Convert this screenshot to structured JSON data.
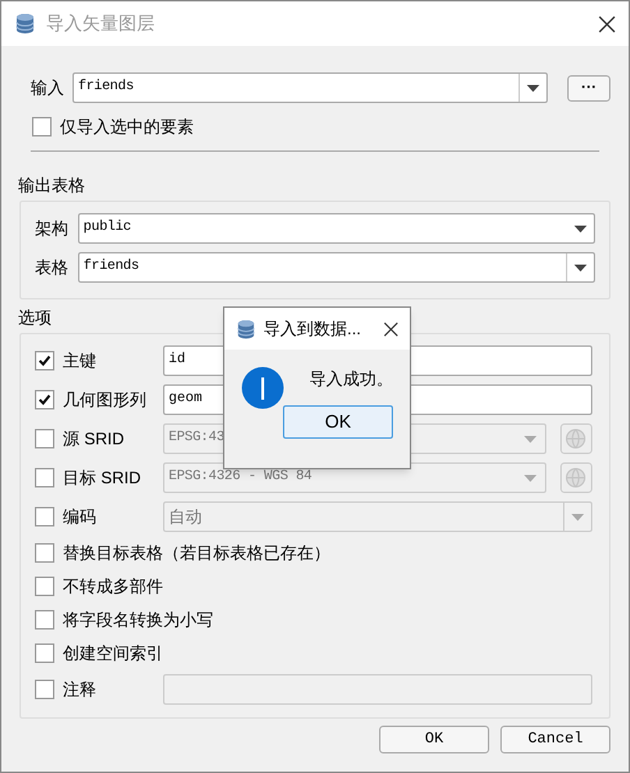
{
  "window": {
    "title": "导入矢量图层"
  },
  "input": {
    "label": "输入",
    "value": "friends",
    "browse": "···"
  },
  "selected_only": {
    "label": "仅导入选中的要素",
    "checked": false
  },
  "output": {
    "title": "输出表格",
    "schema": {
      "label": "架构",
      "value": "public"
    },
    "table": {
      "label": "表格",
      "value": "friends"
    }
  },
  "options": {
    "title": "选项",
    "rows": [
      {
        "kind": "field",
        "label": "主键",
        "checked": true,
        "value": "id"
      },
      {
        "kind": "field",
        "label": "几何图形列",
        "checked": true,
        "value": "geom"
      },
      {
        "kind": "crs",
        "label": "源 SRID",
        "checked": false,
        "value": "EPSG:43"
      },
      {
        "kind": "crs",
        "label": "目标 SRID",
        "checked": false,
        "value": "EPSG:4326 - WGS 84"
      },
      {
        "kind": "combo",
        "label": "编码",
        "checked": false,
        "value": "自动"
      },
      {
        "kind": "check",
        "label": "替换目标表格（若目标表格已存在）",
        "checked": false
      },
      {
        "kind": "check",
        "label": "不转成多部件",
        "checked": false
      },
      {
        "kind": "check",
        "label": "将字段名转换为小写",
        "checked": false
      },
      {
        "kind": "check",
        "label": "创建空间索引",
        "checked": false
      },
      {
        "kind": "blank",
        "label": "注释",
        "checked": false
      }
    ]
  },
  "buttons": [
    "OK",
    "Cancel"
  ],
  "message": {
    "title": "导入到数据...",
    "text": "导入成功。",
    "button": "OK"
  }
}
